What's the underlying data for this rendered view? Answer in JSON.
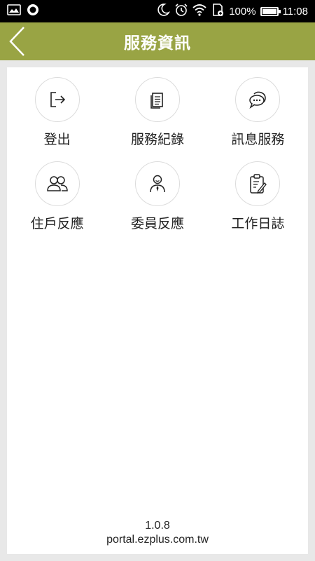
{
  "status_bar": {
    "battery": "100%",
    "battery_level": 1.0,
    "time": "11:08"
  },
  "header": {
    "title": "服務資訊"
  },
  "menu": [
    {
      "label": "登出",
      "icon": "logout-icon"
    },
    {
      "label": "服務紀錄",
      "icon": "document-icon"
    },
    {
      "label": "訊息服務",
      "icon": "chat-icon"
    },
    {
      "label": "住戶反應",
      "icon": "users-icon"
    },
    {
      "label": "委員反應",
      "icon": "committee-member-icon"
    },
    {
      "label": "工作日誌",
      "icon": "clipboard-edit-icon"
    }
  ],
  "footer": {
    "version": "1.0.8",
    "url": "portal.ezplus.com.tw"
  },
  "colors": {
    "header_bg": "#99a444",
    "page_bg": "#e8e8e8",
    "card_bg": "#ffffff"
  }
}
